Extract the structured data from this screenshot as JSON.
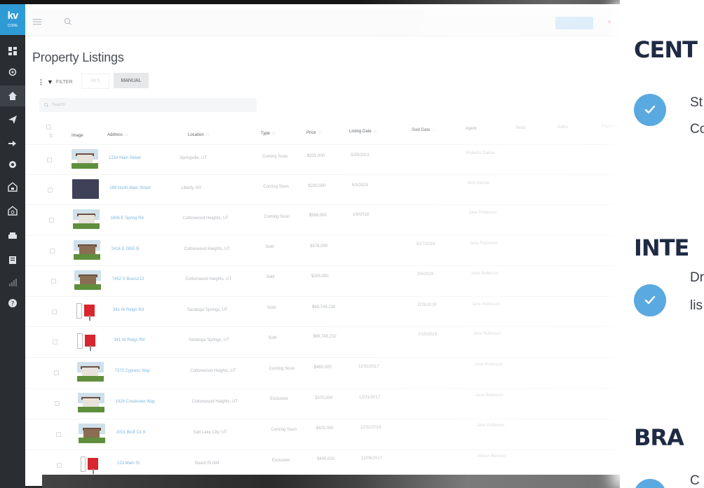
{
  "app": {
    "logo_mark": "kv",
    "logo_sub": "CORE"
  },
  "page": {
    "title": "Property Listings",
    "filter_label": "FILTER",
    "toggle_mls": "MLS",
    "toggle_manual": "MANUAL",
    "search_placeholder": "Search"
  },
  "table": {
    "columns": [
      "Image",
      "Address",
      "Location",
      "Type",
      "Price",
      "Listing Date",
      "Sold Date",
      "Agent",
      "Beds",
      "Baths",
      "Features"
    ],
    "rows": [
      {
        "address": "1234 Main Street",
        "location": "Springville, UT",
        "type": "Coming Soon",
        "price": "$315,000",
        "listing_date": "5/25/2019",
        "sold_date": "",
        "agent": "Roberto Garcia",
        "thumb": "house"
      },
      {
        "address": "189 North Main Street",
        "location": "Liberty, NY",
        "type": "Coming Soon",
        "price": "$220,000",
        "listing_date": "5/3/2019",
        "sold_date": "",
        "agent": "Nick Metzer",
        "thumb": "dark"
      },
      {
        "address": "1806 E Spring Rd",
        "location": "Cottonwood Heights, UT",
        "type": "Coming Soon",
        "price": "$569,000",
        "listing_date": "1/8/2018",
        "sold_date": "",
        "agent": "Jane Robinson",
        "thumb": "house"
      },
      {
        "address": "2416 E 2650 B",
        "location": "Cottonwood Heights, UT",
        "type": "Sold",
        "price": "$376,000",
        "listing_date": "",
        "sold_date": "5/17/2019",
        "agent": "Jane Robinson",
        "thumb": "tree"
      },
      {
        "address": "7452 S Bound Ct",
        "location": "Cottonwood Heights, UT",
        "type": "Sold",
        "price": "$255,000",
        "listing_date": "",
        "sold_date": "2/5/2019",
        "agent": "Jane Robinson",
        "thumb": "tree"
      },
      {
        "address": "341 W Reign Rd",
        "location": "Saratoga Springs, UT",
        "type": "Sold",
        "price": "$69,749,230",
        "listing_date": "",
        "sold_date": "2/15/2019",
        "agent": "Jane Robinson",
        "thumb": "sign"
      },
      {
        "address": "341 W Reign Rd",
        "location": "Saratoga Springs, UT",
        "type": "Sold",
        "price": "$69,749,232",
        "listing_date": "",
        "sold_date": "2/15/2019",
        "agent": "Jane Robinson",
        "thumb": "sign"
      },
      {
        "address": "7373 Cypress Way",
        "location": "Cottonwood Heights, UT",
        "type": "Coming Soon",
        "price": "$465,000",
        "listing_date": "12/31/2017",
        "sold_date": "",
        "agent": "Jane Robinson",
        "thumb": "house"
      },
      {
        "address": "1428 Creekview Way",
        "location": "Cottonwood Heights, UT",
        "type": "Exclusive",
        "price": "$370,000",
        "listing_date": "12/31/2017",
        "sold_date": "",
        "agent": "Jane Robinson",
        "thumb": "house"
      },
      {
        "address": "2001 Bluff Cir S",
        "location": "Salt Lake City, UT",
        "type": "Coming Soon",
        "price": "$425,000",
        "listing_date": "12/31/2018",
        "sold_date": "",
        "agent": "Jane Robinson",
        "thumb": "tree"
      },
      {
        "address": "123 Main St",
        "location": "Board PLNM",
        "type": "Exclusive",
        "price": "$400,000",
        "listing_date": "12/06/2017",
        "sold_date": "",
        "agent": "Allison Bertram",
        "thumb": "sign"
      }
    ]
  },
  "panel": {
    "heading_1": "CENT",
    "text_1_line_1": "St",
    "text_1_line_2": "Co",
    "heading_2": "INTE",
    "text_2_line_1": "Dr",
    "text_2_line_2": "lis",
    "heading_3": "BRA",
    "text_3_line_1": "C"
  },
  "colors": {
    "accent": "#2f9bd6",
    "check": "#5aa9e0",
    "heading": "#1f2a44",
    "nav": "#2a2d32"
  }
}
